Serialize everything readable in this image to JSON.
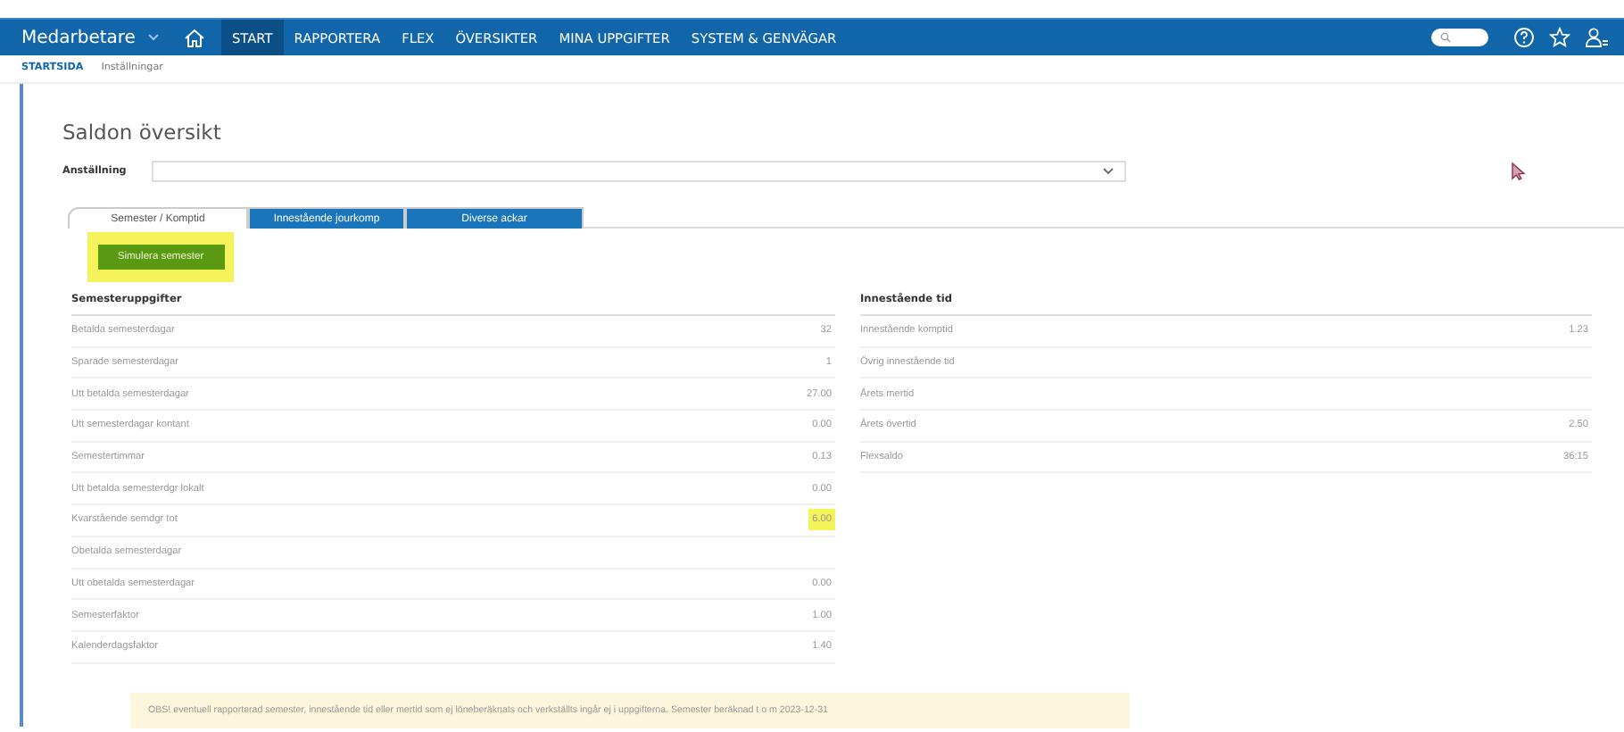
{
  "nav": {
    "app_menu": "Medarbetare",
    "items": [
      {
        "label": "START",
        "selected": true
      },
      {
        "label": "RAPPORTERA",
        "selected": false
      },
      {
        "label": "FLEX",
        "selected": false
      },
      {
        "label": "ÖVERSIKTER",
        "selected": false
      },
      {
        "label": "MINA UPPGIFTER",
        "selected": false
      },
      {
        "label": "SYSTEM & GENVÄGAR",
        "selected": false
      }
    ]
  },
  "breadcrumb": [
    {
      "label": "STARTSIDA",
      "selected": true
    },
    {
      "label": "Inställningar",
      "selected": false
    }
  ],
  "page_title": "Saldon översikt",
  "employment": {
    "label": "Anställning"
  },
  "tabs": [
    {
      "label": "Semester / Komptid",
      "selected": true
    },
    {
      "label": "Innestående jourkomp",
      "selected": false
    },
    {
      "label": "Diverse ackar",
      "selected": false
    }
  ],
  "simulate_button": {
    "label": "Simulera semester",
    "highlighted": true
  },
  "sections": [
    {
      "title": "Semesteruppgifter",
      "rows": [
        {
          "label": "Betalda semesterdagar",
          "value": "32"
        },
        {
          "label": "Sparade semesterdagar",
          "value": "1"
        },
        {
          "label": "Utt betalda semesterdagar",
          "value": "27.00"
        },
        {
          "label": "Utt semesterdagar kontant",
          "value": "0.00"
        },
        {
          "label": "Semestertimmar",
          "value": "0.13"
        },
        {
          "label": "Utt betalda semesterdgr lokalt",
          "value": "0.00"
        },
        {
          "label": "Kvarstående semdgr tot",
          "value": "6.00",
          "highlighted": true
        },
        {
          "label": "Obetalda semesterdagar"
        },
        {
          "label": "Utt obetalda semesterdagar",
          "value": "0.00"
        },
        {
          "label": "Semesterfaktor",
          "value": "1.00"
        },
        {
          "label": "Kalenderdagsfaktor",
          "value": "1.40"
        }
      ]
    },
    {
      "title": "Innestående tid",
      "rows": [
        {
          "label": "Innestående komptid",
          "value": "1.23"
        },
        {
          "label": "Övrig innestående tid"
        },
        {
          "label": "Årets mertid"
        },
        {
          "label": "Årets övertid",
          "value": "2.50"
        },
        {
          "label": "Flexsaldo",
          "value": "36:15"
        }
      ]
    }
  ],
  "note": "OBS! eventuell rapporterad semester, innestående tid eller mertid som ej löneberäknats och verkställts ingår ej i uppgifterna. Semester beräknad t o m 2023-12-31"
}
